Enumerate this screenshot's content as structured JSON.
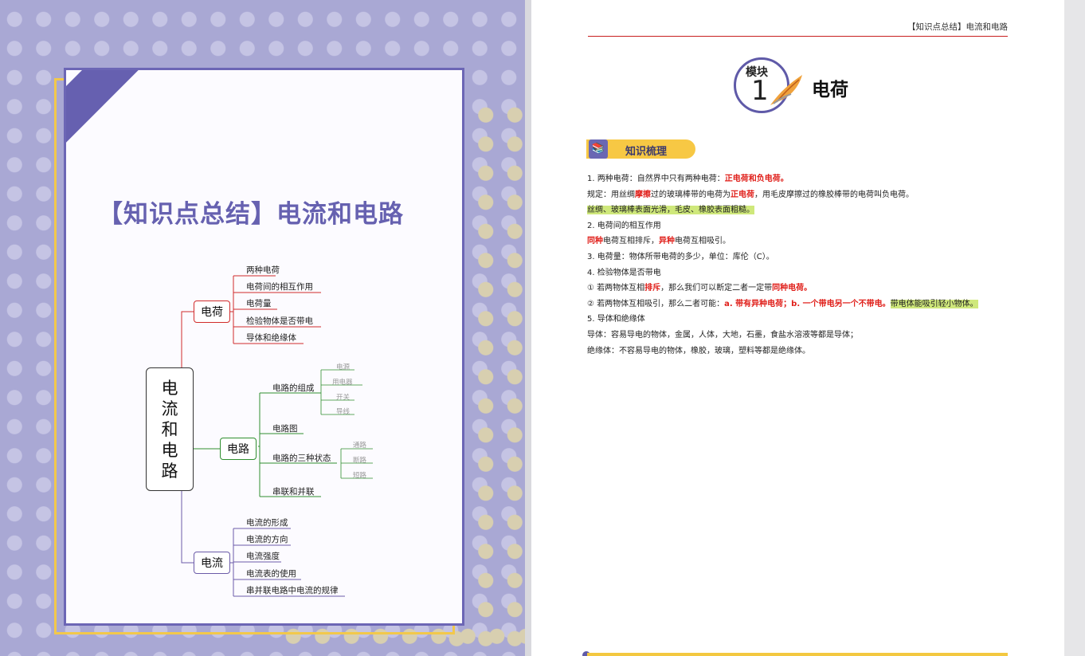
{
  "cover": {
    "title": "【知识点总结】电流和电路",
    "mindmap": {
      "root": [
        "电",
        "流",
        "和",
        "电",
        "路"
      ],
      "branches": [
        {
          "label": "电荷",
          "color": "#d12b2b",
          "leaves": [
            "两种电荷",
            "电荷间的相互作用",
            "电荷量",
            "检验物体是否带电",
            "导体和绝缘体"
          ]
        },
        {
          "label": "电路",
          "color": "#2f8f2f",
          "leaves": [
            "电路的组成",
            "电路图",
            "电路的三种状态",
            "串联和并联"
          ],
          "sub": {
            "组成": [
              "电源",
              "用电器",
              "开关",
              "导线"
            ],
            "状态": [
              "通路",
              "断路",
              "短路"
            ]
          }
        },
        {
          "label": "电流",
          "color": "#6b5ba8",
          "leaves": [
            "电流的形成",
            "电流的方向",
            "电流强度",
            "电流表的使用",
            "串并联电路中电流的规律"
          ]
        }
      ]
    }
  },
  "page": {
    "running_head": "【知识点总结】电流和电路",
    "module_word": "模块",
    "module_num": "1",
    "module_title": "电荷",
    "section_label": "知识梳理"
  },
  "content": {
    "l1_a": "1. 两种电荷：自然界中只有两种电荷：",
    "l1_b": "正电荷和负电荷。",
    "l2_a": "规定：用丝绸",
    "l2_b": "摩擦",
    "l2_c": "过的玻璃棒带的电荷为",
    "l2_d": "正电荷",
    "l2_e": "，用毛皮摩擦过的橡胶棒带的电荷叫负电荷。",
    "l3": "丝绸、玻璃棒表面光滑，毛皮、橡胶表面粗糙。",
    "l4": "2. 电荷间的相互作用",
    "l5_a": "同种",
    "l5_b": "电荷互相排斥，",
    "l5_c": "异种",
    "l5_d": "电荷互相吸引。",
    "l6": "3. 电荷量：物体所带电荷的多少，单位：库伦（C）。",
    "l7": "4. 检验物体是否带电",
    "l8_a": "① 若两物体互相",
    "l8_b": "排斥",
    "l8_c": "，那么我们可以断定二者一定带",
    "l8_d": "同种电荷。",
    "l9_a": "② 若两物体互相吸引，那么二者可能：",
    "l9_b": "a. 带有异种电荷；b. 一个带电另一个不带电。",
    "l9_c": "带电体能吸引轻小物体。",
    "l10": "5. 导体和绝缘体",
    "l11": "导体：容易导电的物体，金属，人体，大地，石墨，食盐水溶液等都是导体；",
    "l12": "绝缘体：不容易导电的物体，橡胶，玻璃，塑料等都是绝缘体。"
  }
}
